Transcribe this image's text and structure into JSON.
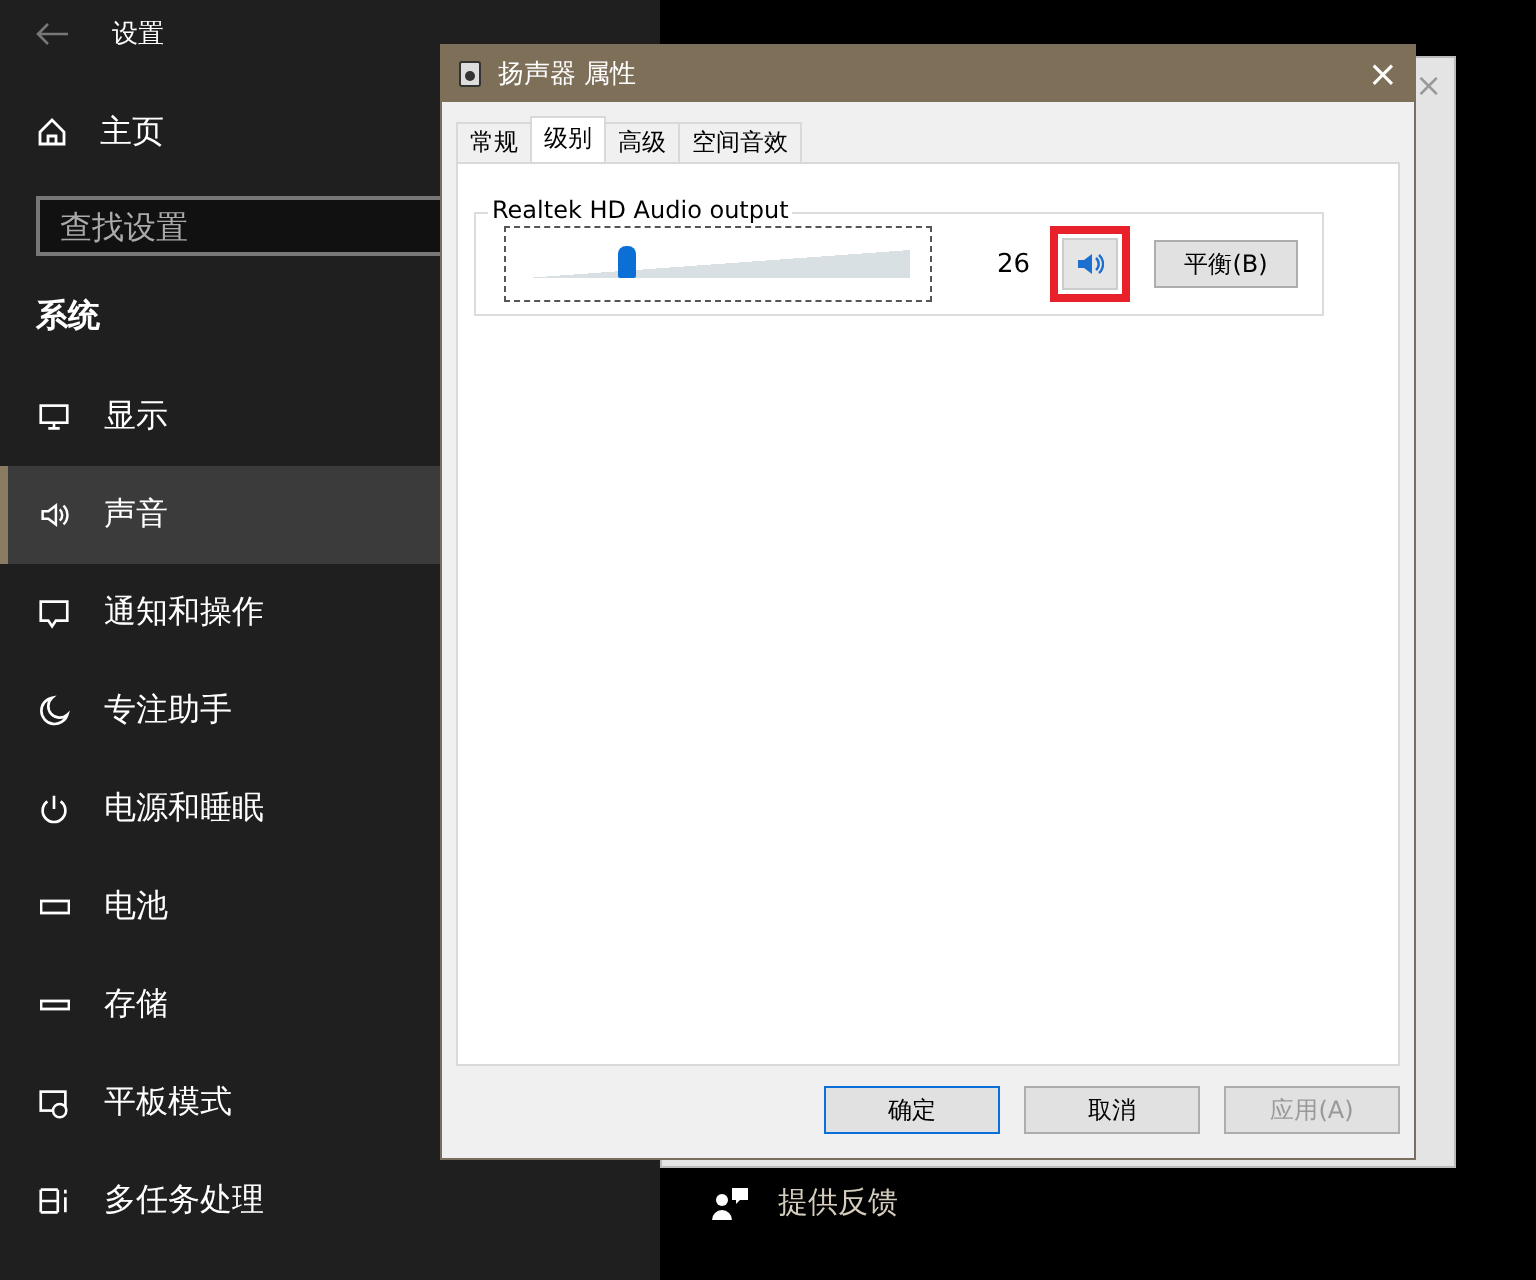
{
  "settings": {
    "title": "设置",
    "home": "主页",
    "search": {
      "placeholder": "查找设置"
    },
    "section": "系统",
    "items": [
      {
        "label": "显示",
        "kind": "display",
        "selected": false
      },
      {
        "label": "声音",
        "kind": "sound",
        "selected": true
      },
      {
        "label": "通知和操作",
        "kind": "message",
        "selected": false
      },
      {
        "label": "专注助手",
        "kind": "moon",
        "selected": false
      },
      {
        "label": "电源和睡眠",
        "kind": "power",
        "selected": false
      },
      {
        "label": "电池",
        "kind": "battery",
        "selected": false
      },
      {
        "label": "存储",
        "kind": "storage",
        "selected": false
      },
      {
        "label": "平板模式",
        "kind": "tablet",
        "selected": false
      },
      {
        "label": "多任务处理",
        "kind": "multitask",
        "selected": false
      }
    ],
    "feedback": "提供反馈"
  },
  "background_window": {
    "close": "×"
  },
  "dialog": {
    "title": "扬声器 属性",
    "close": "×",
    "tabs": [
      {
        "label": "常规",
        "selected": false
      },
      {
        "label": "级别",
        "selected": true
      },
      {
        "label": "高级",
        "selected": false
      },
      {
        "label": "空间音效",
        "selected": false
      }
    ],
    "group": "Realtek HD Audio output",
    "volume": {
      "level": 0.26,
      "reading": "26",
      "muted": false,
      "highlighted": true
    },
    "balance_button": "平衡(B)",
    "buttons": [
      {
        "label": "确定",
        "default": true,
        "disabled": false
      },
      {
        "label": "取消",
        "default": false,
        "disabled": false
      },
      {
        "label": "应用(A)",
        "default": false,
        "disabled": true
      }
    ]
  }
}
